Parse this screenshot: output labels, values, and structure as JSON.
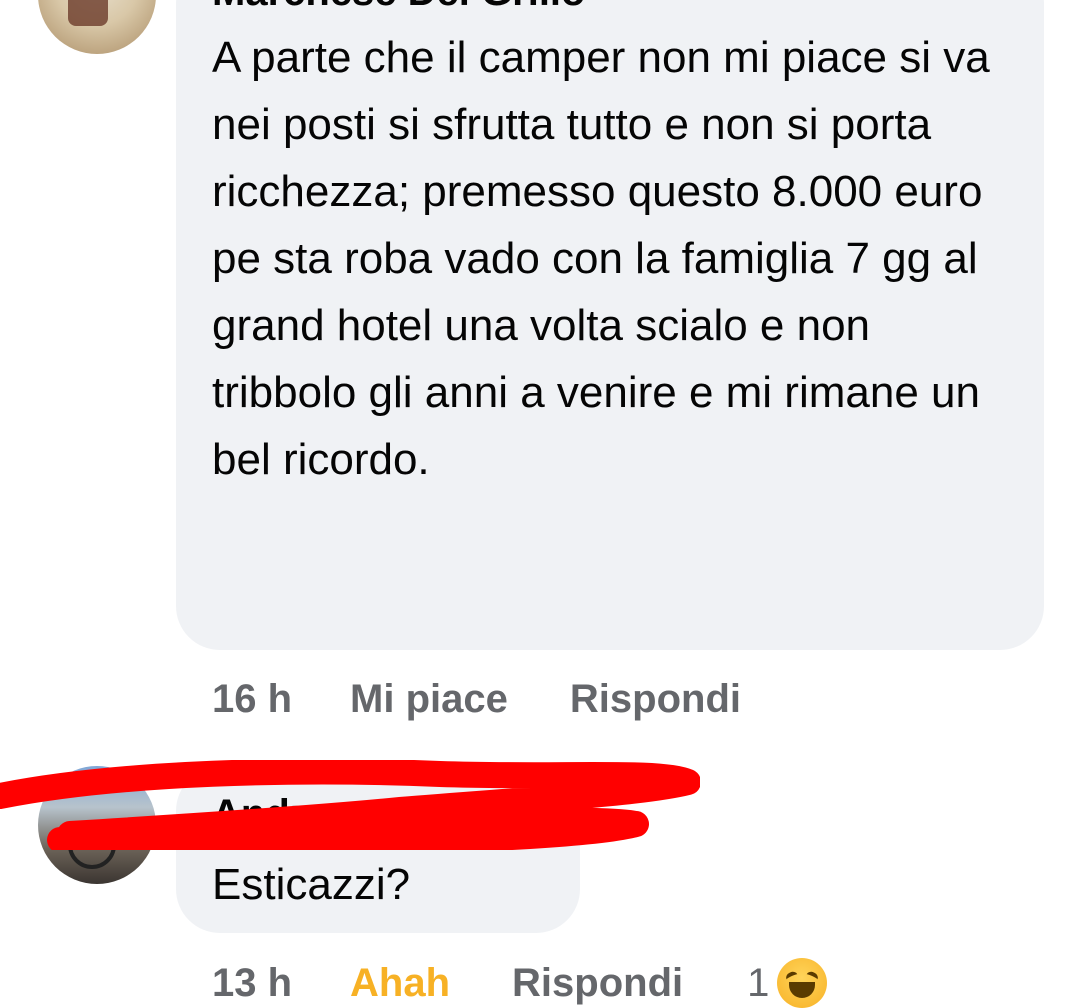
{
  "comments": [
    {
      "author": "Marchese Del Grillo",
      "text": "A parte che il camper non mi piace si va nei posti si sfrutta tutto e non si porta ricchezza; premesso questo 8.000 euro pe sta roba vado con la famiglia 7 gg al grand hotel una volta scialo e non tribbolo gli anni a venire e mi rimane un bel ricordo.",
      "time": "16 h",
      "like_label": "Mi piace",
      "reply_label": "Rispondi"
    },
    {
      "author": "Andrea",
      "text": "Esticazzi?",
      "time": "13 h",
      "reaction_label": "Ahah",
      "reply_label": "Rispondi",
      "reaction_count": "1",
      "reaction_icon": "laughing-emoji-icon"
    }
  ],
  "colors": {
    "bubble": "#f0f2f5",
    "meta": "#65676b",
    "ahah": "#f7b125",
    "redaction": "#ff0000"
  }
}
